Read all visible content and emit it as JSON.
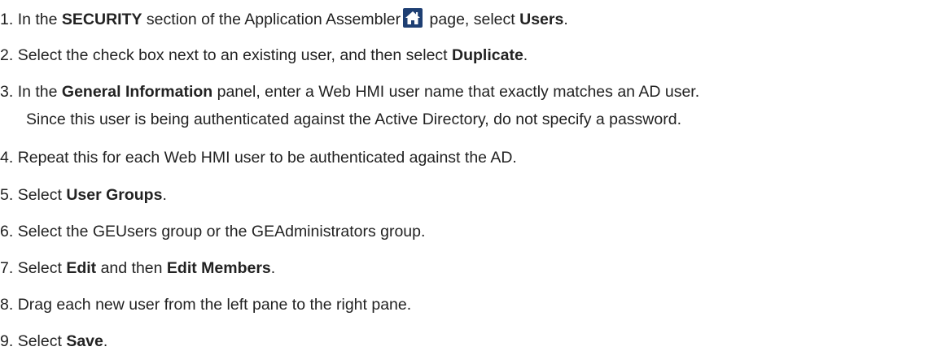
{
  "steps": [
    {
      "num": "1.",
      "parts": {
        "a": "In the ",
        "b": "SECURITY",
        "c": " section of the Application Assembler",
        "d": " page, select ",
        "e": "Users",
        "f": "."
      },
      "icon": "home-icon"
    },
    {
      "num": "2.",
      "parts": {
        "a": "Select the check box next to an existing user, and then select ",
        "b": "Duplicate",
        "c": "."
      }
    },
    {
      "num": "3.",
      "parts": {
        "a": "In the ",
        "b": "General Information",
        "c": " panel, enter a Web HMI user name that exactly matches an AD user."
      },
      "continuation": "Since this user is being authenticated against the Active Directory, do not specify a password."
    },
    {
      "num": "4.",
      "parts": {
        "a": "Repeat this for each Web HMI user to be authenticated against the AD."
      }
    },
    {
      "num": "5.",
      "parts": {
        "a": "Select ",
        "b": "User Groups",
        "c": "."
      }
    },
    {
      "num": "6.",
      "parts": {
        "a": "Select the GEUsers group or the GEAdministrators group."
      }
    },
    {
      "num": "7.",
      "parts": {
        "a": "Select ",
        "b": "Edit",
        "c": " and then ",
        "d": "Edit Members",
        "e": "."
      }
    },
    {
      "num": "8.",
      "parts": {
        "a": "Drag each new user from the left pane to the right pane."
      }
    },
    {
      "num": "9.",
      "parts": {
        "a": "Select ",
        "b": "Save",
        "c": "."
      }
    }
  ],
  "colors": {
    "text": "#222222",
    "icon_bg": "#1e3f73",
    "icon_fg": "#ffffff"
  }
}
